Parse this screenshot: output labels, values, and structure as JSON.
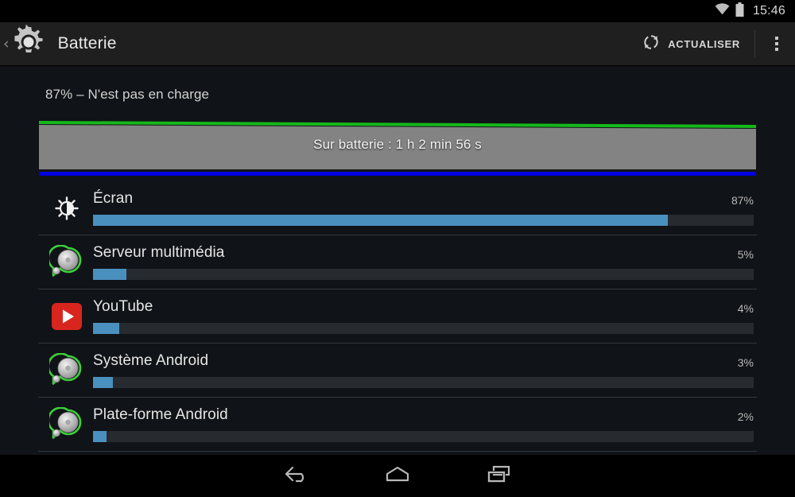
{
  "status_bar": {
    "time": "15:46",
    "icons": [
      "wifi-icon",
      "battery-icon"
    ]
  },
  "action_bar": {
    "back_icon": "back-chevron-icon",
    "app_icon": "settings-gear-icon",
    "title": "Batterie",
    "refresh_icon": "refresh-icon",
    "refresh_label": "ACTUALISER",
    "overflow_icon": "overflow-menu-icon"
  },
  "battery": {
    "charge_status": "87% – N'est pas en charge",
    "graph_label": "Sur batterie : 1 h 2 min 56 s",
    "graph_level_line_color": "#15b81a",
    "graph_fill_color": "#838383",
    "graph_bottom_line_color": "#0000e0",
    "graph_level_start_pct": 88,
    "graph_level_end_pct": 85
  },
  "usage": {
    "bar_color": "#4a90bf",
    "track_color": "#272b30",
    "items": [
      {
        "name": "Écran",
        "percent": "87%",
        "value": 87,
        "icon": "brightness-icon"
      },
      {
        "name": "Serveur multimédia",
        "percent": "5%",
        "value": 5,
        "icon": "android-system-icon"
      },
      {
        "name": "YouTube",
        "percent": "4%",
        "value": 4,
        "icon": "youtube-icon"
      },
      {
        "name": "Système Android",
        "percent": "3%",
        "value": 3,
        "icon": "android-system-icon"
      },
      {
        "name": "Plate-forme Android",
        "percent": "2%",
        "value": 2,
        "icon": "android-system-icon"
      }
    ]
  },
  "nav_bar": {
    "back_label": "back-nav-icon",
    "home_label": "home-nav-icon",
    "recents_label": "recents-nav-icon"
  }
}
